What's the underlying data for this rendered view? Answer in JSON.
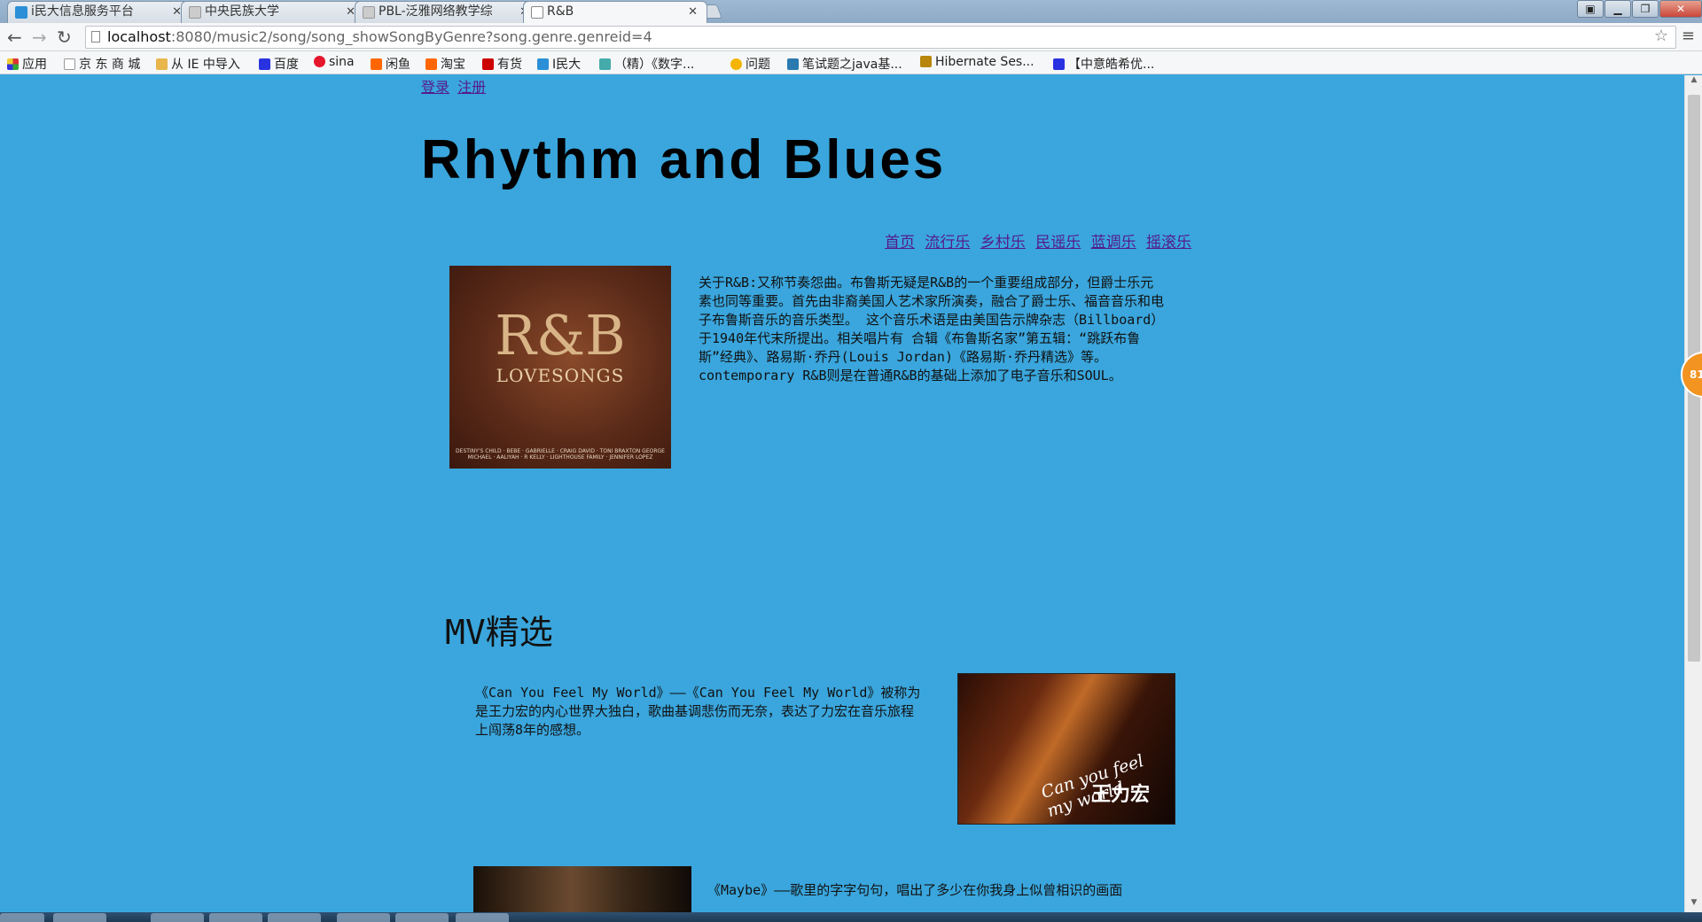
{
  "browser": {
    "tabs": [
      {
        "label": "i民大信息服务平台",
        "color": "#2a8fd6"
      },
      {
        "label": "中央民族大学",
        "color": "#cccccc"
      },
      {
        "label": "PBL-泛雅网络教学综",
        "color": "#cccccc"
      },
      {
        "label": "R&B",
        "color": "#999999"
      }
    ],
    "url": {
      "host": "localhost",
      "rest": ":8080/music2/song/song_showSongByGenre?song.genre.genreid=4"
    },
    "bookmarks": [
      {
        "label": "应用",
        "color": "#d33"
      },
      {
        "label": "京 东 商 城",
        "color": "#999"
      },
      {
        "label": "从 IE 中导入",
        "color": "#e8b64b"
      },
      {
        "label": "百度",
        "color": "#2932e1"
      },
      {
        "label": "sina",
        "color": "#e6162d"
      },
      {
        "label": "闲鱼",
        "color": "#f60"
      },
      {
        "label": "淘宝",
        "color": "#f60"
      },
      {
        "label": "有货",
        "color": "#c00"
      },
      {
        "label": "I民大",
        "color": "#2a8fd6"
      },
      {
        "label": "（精）《数字...",
        "color": "#4aa"
      },
      {
        "label": "问题",
        "color": "#f5b400"
      },
      {
        "label": "笔试题之java基...",
        "color": "#2a7ab0"
      },
      {
        "label": "Hibernate Ses...",
        "color": "#b8860b"
      },
      {
        "label": "【中意皓希优...",
        "color": "#2932e1"
      }
    ]
  },
  "page": {
    "auth": {
      "login": "登录",
      "register": "注册"
    },
    "title": "Rhythm and Blues",
    "genres": [
      "首页",
      "流行乐",
      "乡村乐",
      "民谣乐",
      "蓝调乐",
      "摇滚乐"
    ],
    "album": {
      "line1": "R&B",
      "line2": "LOVESONGS",
      "credits": "DESTINY'S CHILD · BEBE · GABRIELLE · CRAIG DAVID · TONI BRAXTON GEORGE MICHAEL · AALIYAH · R KELLY · LIGHTHOUSE FAMILY · JENNIFER LOPEZ"
    },
    "description": "关于R&B:又称节奏怨曲。布鲁斯无疑是R&B的一个重要组成部分，但爵士乐元素也同等重要。首先由非裔美国人艺术家所演奏，融合了爵士乐、福音音乐和电子布鲁斯音乐的音乐类型。 这个音乐术语是由美国告示牌杂志（Billboard）于1940年代末所提出。相关唱片有 合辑《布鲁斯名家”第五辑：“跳跃布鲁斯”经典》、路易斯·乔丹(Louis Jordan)《路易斯·乔丹精选》等。contemporary R&B则是在普通R&B的基础上添加了电子音乐和SOUL。",
    "mv_heading": "MV精选",
    "mvs": [
      {
        "text": "《Can You Feel My World》——《Can You Feel My World》被称为是王力宏的内心世界大独白，歌曲基调悲伤而无奈，表达了力宏在音乐旅程上闯荡8年的感想。",
        "caption_en": "Can you feel my world",
        "caption_cn": "王力宏"
      },
      {
        "text": "《Maybe》——歌里的字字句句，唱出了多少在你我身上似曾相识的画面"
      }
    ],
    "badge": "81"
  }
}
